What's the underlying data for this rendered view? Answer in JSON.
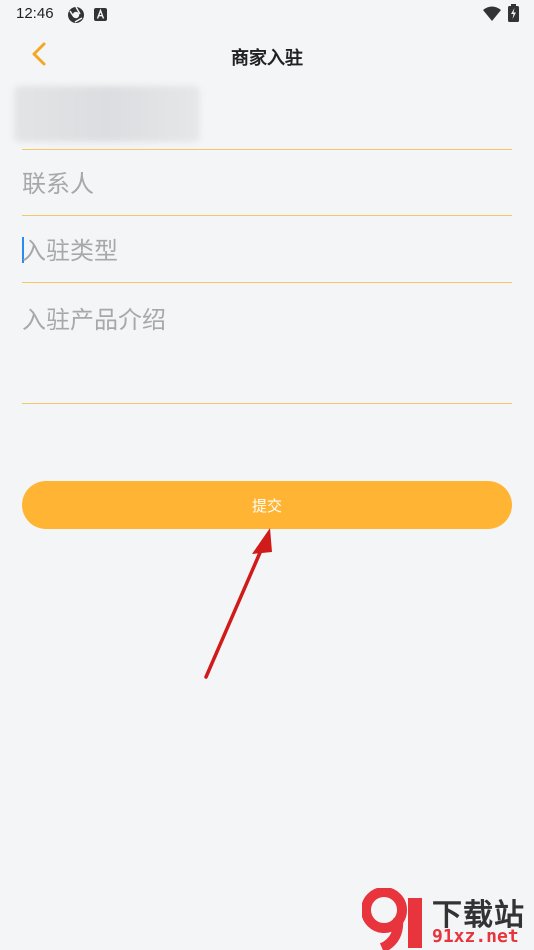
{
  "status_bar": {
    "time": "12:46",
    "icons": [
      "chrome-icon",
      "a-notification-icon",
      "wifi-icon",
      "battery-charging-icon"
    ]
  },
  "header": {
    "back_icon": "chevron-left-icon",
    "title": "商家入驻"
  },
  "form": {
    "contact": {
      "value": "",
      "placeholder": "联系人"
    },
    "type": {
      "value": "",
      "placeholder": "入驻类型"
    },
    "intro": {
      "value": "",
      "placeholder": "入驻产品介绍"
    }
  },
  "submit": {
    "label": "提交"
  },
  "watermark": {
    "title": "下载站",
    "site": "91xz.net"
  },
  "colors": {
    "accent": "#ffb533",
    "divider": "#f5c66a",
    "back_icon": "#f5a623",
    "arrow": "#d11a1a",
    "cursor": "#2b8cf0"
  }
}
